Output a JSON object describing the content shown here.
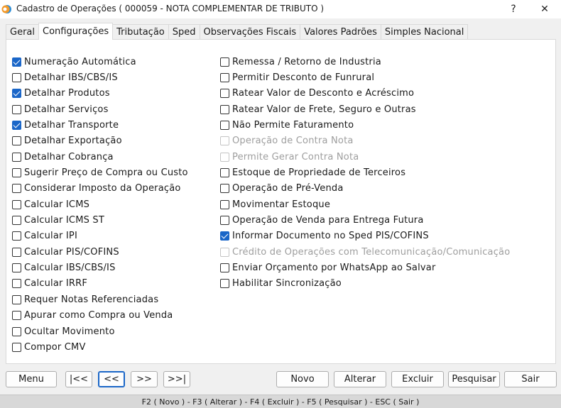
{
  "window": {
    "title": "Cadastro de Operações ( 000059 - NOTA COMPLEMENTAR DE TRIBUTO )",
    "help_label": "?",
    "close_label": "✕"
  },
  "tabs": [
    {
      "label": "Geral",
      "active": false
    },
    {
      "label": "Configurações",
      "active": true
    },
    {
      "label": "Tributação",
      "active": false
    },
    {
      "label": "Sped",
      "active": false
    },
    {
      "label": "Observações Fiscais",
      "active": false
    },
    {
      "label": "Valores Padrões",
      "active": false
    },
    {
      "label": "Simples Nacional",
      "active": false
    }
  ],
  "left_options": [
    {
      "label": "Numeração Automática",
      "checked": true,
      "enabled": true
    },
    {
      "label": "Detalhar IBS/CBS/IS",
      "checked": false,
      "enabled": true
    },
    {
      "label": "Detalhar Produtos",
      "checked": true,
      "enabled": true
    },
    {
      "label": "Detalhar Serviços",
      "checked": false,
      "enabled": true
    },
    {
      "label": "Detalhar Transporte",
      "checked": true,
      "enabled": true
    },
    {
      "label": "Detalhar Exportação",
      "checked": false,
      "enabled": true
    },
    {
      "label": "Detalhar Cobrança",
      "checked": false,
      "enabled": true
    },
    {
      "label": "Sugerir Preço de Compra ou Custo",
      "checked": false,
      "enabled": true
    },
    {
      "label": "Considerar Imposto da Operação",
      "checked": false,
      "enabled": true
    },
    {
      "label": "Calcular ICMS",
      "checked": false,
      "enabled": true
    },
    {
      "label": "Calcular ICMS ST",
      "checked": false,
      "enabled": true
    },
    {
      "label": "Calcular IPI",
      "checked": false,
      "enabled": true
    },
    {
      "label": "Calcular PIS/COFINS",
      "checked": false,
      "enabled": true
    },
    {
      "label": "Calcular IBS/CBS/IS",
      "checked": false,
      "enabled": true
    },
    {
      "label": "Calcular IRRF",
      "checked": false,
      "enabled": true
    },
    {
      "label": "Requer Notas Referenciadas",
      "checked": false,
      "enabled": true
    },
    {
      "label": "Apurar como Compra ou Venda",
      "checked": false,
      "enabled": true
    },
    {
      "label": "Ocultar Movimento",
      "checked": false,
      "enabled": true
    },
    {
      "label": "Compor CMV",
      "checked": false,
      "enabled": true
    }
  ],
  "right_options": [
    {
      "label": "Remessa / Retorno de Industria",
      "checked": false,
      "enabled": true
    },
    {
      "label": "Permitir Desconto de Funrural",
      "checked": false,
      "enabled": true
    },
    {
      "label": "Ratear Valor de Desconto e Acréscimo",
      "checked": false,
      "enabled": true
    },
    {
      "label": "Ratear Valor de Frete, Seguro e Outras",
      "checked": false,
      "enabled": true
    },
    {
      "label": "Não Permite Faturamento",
      "checked": false,
      "enabled": true
    },
    {
      "label": "Operação de Contra Nota",
      "checked": false,
      "enabled": false
    },
    {
      "label": "Permite Gerar Contra Nota",
      "checked": false,
      "enabled": false
    },
    {
      "label": "Estoque de Propriedade de Terceiros",
      "checked": false,
      "enabled": true
    },
    {
      "label": "Operação de Pré-Venda",
      "checked": false,
      "enabled": true
    },
    {
      "label": "Movimentar Estoque",
      "checked": false,
      "enabled": true
    },
    {
      "label": "Operação de Venda para Entrega Futura",
      "checked": false,
      "enabled": true
    },
    {
      "label": "Informar Documento no Sped PIS/COFINS",
      "checked": true,
      "enabled": true
    },
    {
      "label": "Crédito de Operações com Telecomunicação/Comunicação",
      "checked": false,
      "enabled": false
    },
    {
      "label": "Enviar Orçamento por WhatsApp ao Salvar",
      "checked": false,
      "enabled": true
    },
    {
      "label": "Habilitar Sincronização",
      "checked": false,
      "enabled": true
    }
  ],
  "buttons": {
    "menu": "Menu",
    "first": "|<<",
    "prev": "<<",
    "next": ">>",
    "last": ">>|",
    "novo": "Novo",
    "alterar": "Alterar",
    "excluir": "Excluir",
    "pesquisar": "Pesquisar",
    "sair": "Sair"
  },
  "status": {
    "shortcuts": "F2 ( Novo )  -  F3 ( Alterar )  -  F4 ( Excluir )  -  F5 ( Pesquisar )  -  ESC ( Sair )"
  },
  "colors": {
    "accent": "#1a66c8",
    "disabled_text": "#9e9e9e"
  }
}
